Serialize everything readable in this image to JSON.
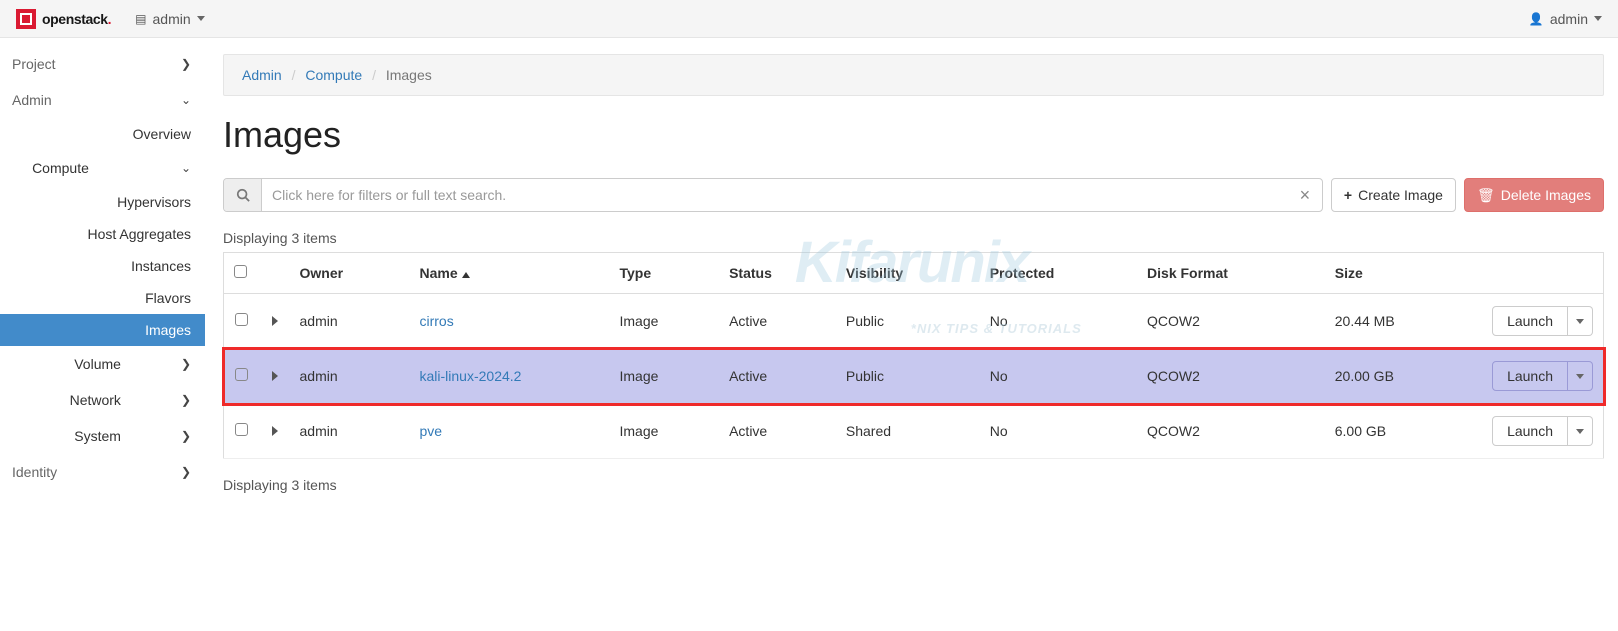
{
  "brand": {
    "name": "openstack",
    "dot": "."
  },
  "topbar": {
    "project_selector": "admin",
    "user_label": "admin"
  },
  "sidebar": {
    "project": "Project",
    "admin": "Admin",
    "overview": "Overview",
    "compute": "Compute",
    "hypervisors": "Hypervisors",
    "host_aggregates": "Host Aggregates",
    "instances": "Instances",
    "flavors": "Flavors",
    "images": "Images",
    "volume": "Volume",
    "network": "Network",
    "system": "System",
    "identity": "Identity"
  },
  "breadcrumb": {
    "admin": "Admin",
    "compute": "Compute",
    "images": "Images"
  },
  "page": {
    "title": "Images"
  },
  "search": {
    "placeholder": "Click here for filters or full text search."
  },
  "buttons": {
    "create_image": "Create Image",
    "delete_images": "Delete Images",
    "launch": "Launch"
  },
  "count_label_top": "Displaying 3 items",
  "count_label_bottom": "Displaying 3 items",
  "columns": {
    "owner": "Owner",
    "name": "Name",
    "type": "Type",
    "status": "Status",
    "visibility": "Visibility",
    "protected": "Protected",
    "disk_format": "Disk Format",
    "size": "Size"
  },
  "rows": [
    {
      "owner": "admin",
      "name": "cirros",
      "type": "Image",
      "status": "Active",
      "visibility": "Public",
      "protected": "No",
      "disk_format": "QCOW2",
      "size": "20.44 MB"
    },
    {
      "owner": "admin",
      "name": "kali-linux-2024.2",
      "type": "Image",
      "status": "Active",
      "visibility": "Public",
      "protected": "No",
      "disk_format": "QCOW2",
      "size": "20.00 GB"
    },
    {
      "owner": "admin",
      "name": "pve",
      "type": "Image",
      "status": "Active",
      "visibility": "Shared",
      "protected": "No",
      "disk_format": "QCOW2",
      "size": "6.00 GB"
    }
  ],
  "watermark": {
    "main": "Kifarunix",
    "sub": "*NIX TIPS & TUTORIALS"
  }
}
